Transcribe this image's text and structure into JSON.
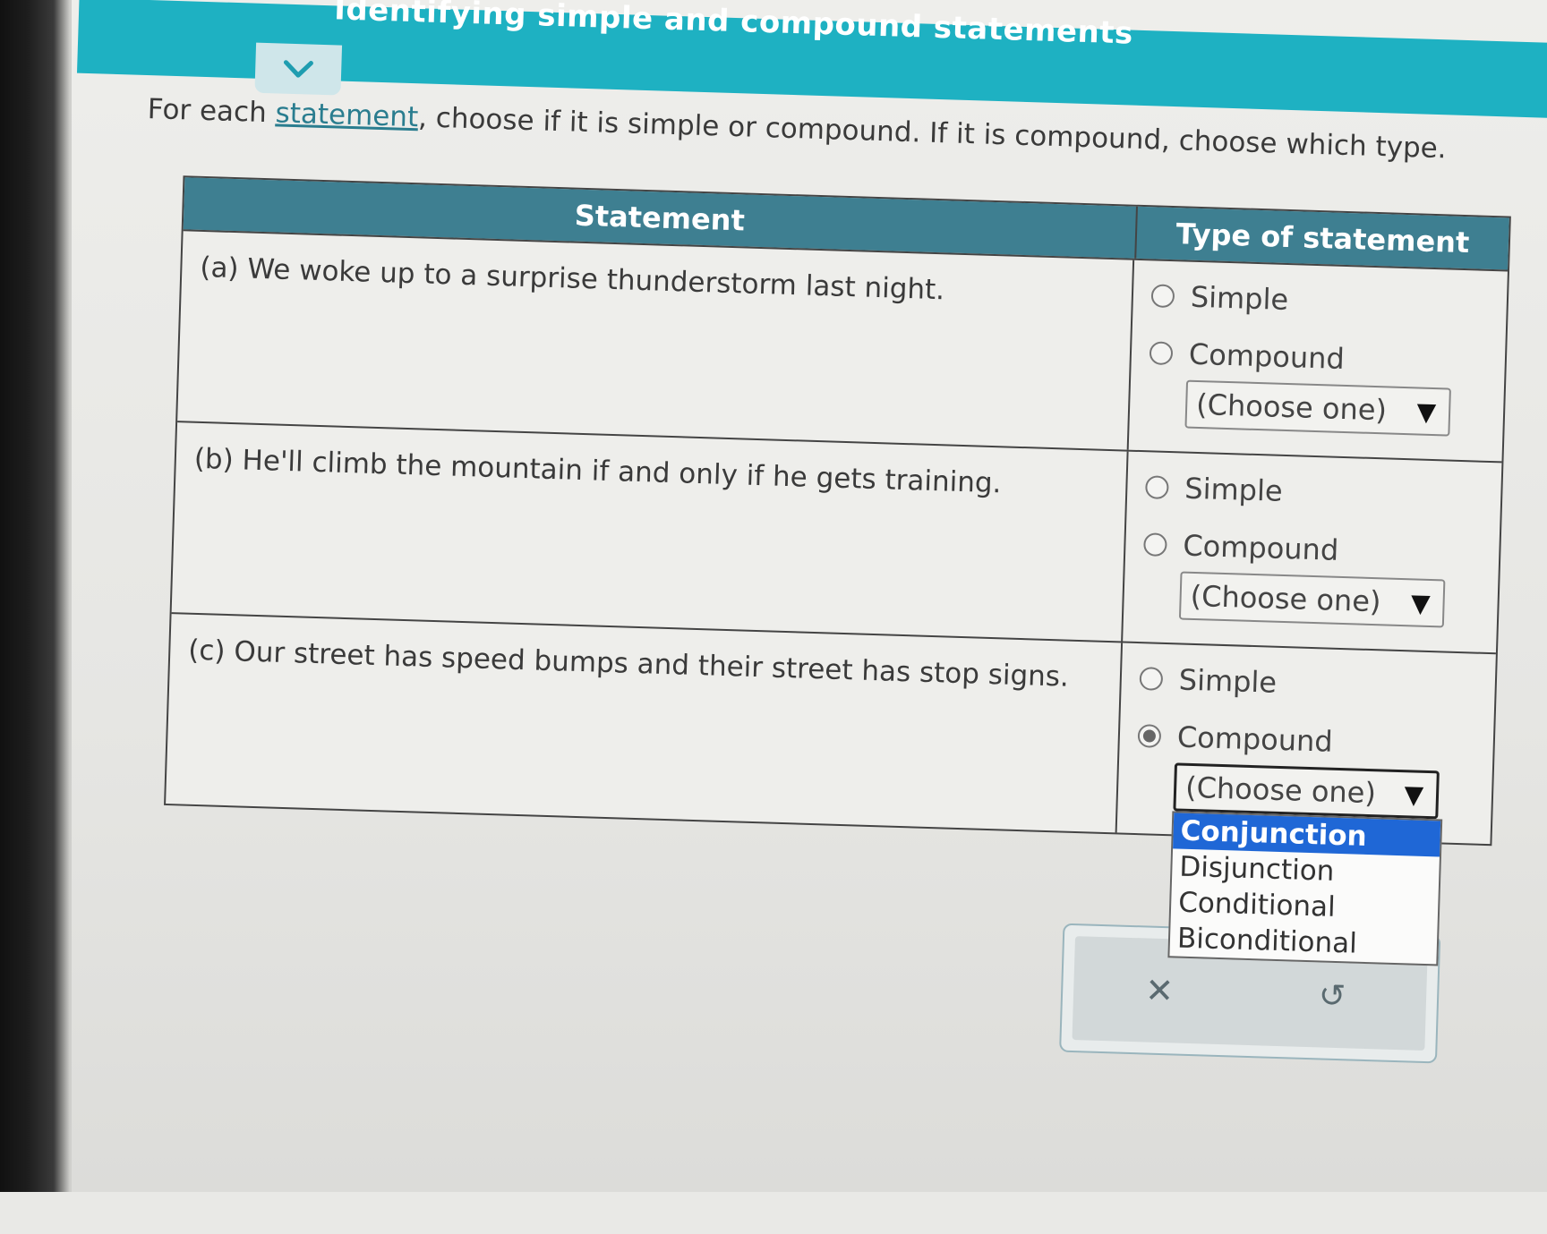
{
  "header": {
    "title": "Identifying simple and compound statements"
  },
  "instructions": {
    "before": "For each ",
    "link": "statement",
    "after": ", choose if it is simple or compound. If it is compound, choose which type."
  },
  "table": {
    "headers": {
      "statement": "Statement",
      "type": "Type of statement"
    },
    "rows": [
      {
        "statement": "(a) We woke up to a surprise thunderstorm last night.",
        "simple": "Simple",
        "compound": "Compound",
        "select": "(Choose one)",
        "selected": "none"
      },
      {
        "statement": "(b) He'll climb the mountain if and only if he gets training.",
        "simple": "Simple",
        "compound": "Compound",
        "select": "(Choose one)",
        "selected": "none"
      },
      {
        "statement": "(c) Our street has speed bumps and their street has stop signs.",
        "simple": "Simple",
        "compound": "Compound",
        "select": "(Choose one)",
        "selected": "compound"
      }
    ]
  },
  "dropdown": {
    "items": [
      "Conjunction",
      "Disjunction",
      "Conditional",
      "Biconditional"
    ],
    "highlighted": "Conjunction"
  },
  "colors": {
    "topbar": "#1eb1c2",
    "table_header": "#3e7f91",
    "highlight": "#1f67d6"
  },
  "icons": {
    "collapse": "chevron-down-icon",
    "clear": "x-icon",
    "undo": "undo-icon",
    "select_caret": "triangle-down-icon"
  }
}
